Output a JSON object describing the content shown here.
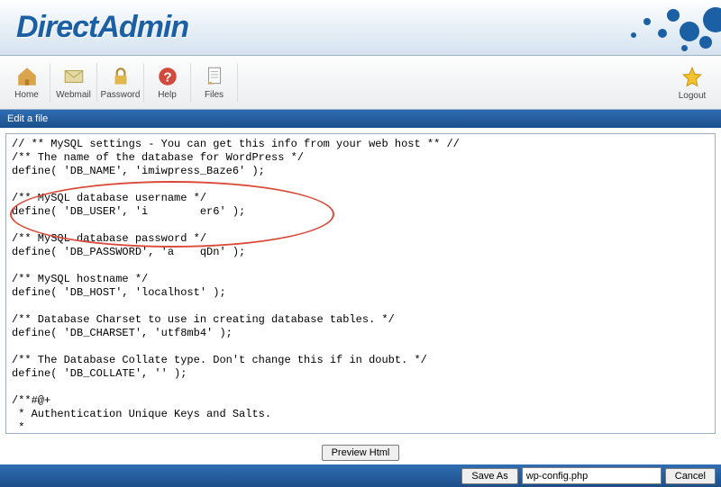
{
  "logo": "DirectAdmin",
  "toolbar": {
    "items": [
      {
        "label": "Home",
        "icon": "home-icon"
      },
      {
        "label": "Webmail",
        "icon": "mail-icon"
      },
      {
        "label": "Password",
        "icon": "lock-icon"
      },
      {
        "label": "Help",
        "icon": "help-icon"
      },
      {
        "label": "Files",
        "icon": "files-icon"
      }
    ],
    "logout_label": "Logout"
  },
  "titlebar": "Edit a file",
  "editor_content": "// ** MySQL settings - You can get this info from your web host ** //\n/** The name of the database for WordPress */\ndefine( 'DB_NAME', 'imiwpress_Baze6' );\n\n/** MySQL database username */\ndefine( 'DB_USER', 'i        er6' );\n\n/** MySQL database password */\ndefine( 'DB_PASSWORD', 'a    qDn' );\n\n/** MySQL hostname */\ndefine( 'DB_HOST', 'localhost' );\n\n/** Database Charset to use in creating database tables. */\ndefine( 'DB_CHARSET', 'utf8mb4' );\n\n/** The Database Collate type. Don't change this if in doubt. */\ndefine( 'DB_COLLATE', '' );\n\n/**#@+\n * Authentication Unique Keys and Salts.\n *\n * Change these to different unique phrases!\n * You can generate these using the {@link https://api.wordpress.org/secret-key/1.1/salt/ WordPress.org secret-key serv",
  "preview_button": "Preview Html",
  "save_as_label": "Save As",
  "cancel_label": "Cancel",
  "filename_value": "wp-config.php",
  "colors": {
    "bar_blue_top": "#2f6db3",
    "bar_blue_bottom": "#1c4f8a",
    "annotation_red": "#d94a3a"
  }
}
